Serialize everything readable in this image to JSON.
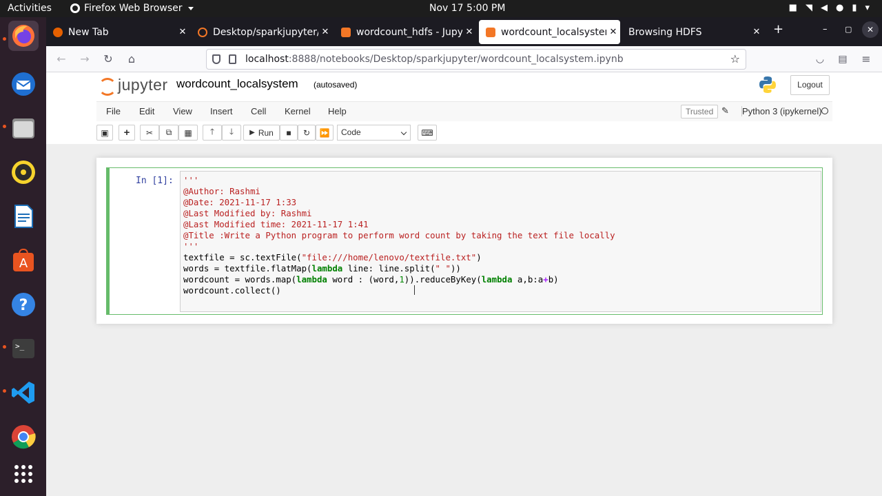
{
  "topbar": {
    "activities": "Activities",
    "app_menu": "Firefox Web Browser",
    "clock": "Nov 17  5:00 PM"
  },
  "tabs": [
    {
      "title": "New Tab",
      "favicon_color": "#e66000"
    },
    {
      "title": "Desktop/sparkjupyter/",
      "favicon_color": "#f37726"
    },
    {
      "title": "wordcount_hdfs - Jupyte",
      "favicon_color": "#f37726"
    },
    {
      "title": "wordcount_localsystem -",
      "favicon_color": "#f37726",
      "active": true
    },
    {
      "title": "Browsing HDFS",
      "favicon_color": "#1c1b22"
    }
  ],
  "url": {
    "host": "localhost",
    "path": ":8888/notebooks/Desktop/sparkjupyter/wordcount_localsystem.ipynb"
  },
  "jupyter": {
    "logo_text": "jupyter",
    "notebook_name": "wordcount_localsystem",
    "autosave_status": "(autosaved)",
    "logout_label": "Logout",
    "menus": [
      "File",
      "Edit",
      "View",
      "Insert",
      "Cell",
      "Kernel",
      "Help"
    ],
    "trusted_label": "Trusted",
    "kernel_name": "Python 3 (ipykernel)",
    "toolbar": {
      "run_label": "Run",
      "cell_type": "Code"
    }
  },
  "cell": {
    "prompt": "In [1]:",
    "lines": [
      "'''",
      "@Author: Rashmi",
      "@Date: 2021-11-17 1:33",
      "@Last Modified by: Rashmi",
      "@Last Modified time: 2021-11-17 1:41",
      "@Title :Write a Python program to perform word count by taking the text file locally",
      "'''"
    ],
    "code_line1": [
      "textfile = sc.textFile(",
      "\"file:///home/lenovo/textfile.txt\"",
      ")"
    ],
    "code_line2": [
      "words = textfile.flatMap(",
      "lambda",
      " line: line.split(",
      "\" \"",
      "))"
    ],
    "code_line3": [
      "wordcount = words.map(",
      "lambda",
      " word : (word,",
      "1",
      ")).reduceByKey(",
      "lambda",
      " a,b:a",
      "+",
      "b)"
    ],
    "code_line4": "wordcount.collect()"
  },
  "colors": {
    "accent_orange": "#f37726",
    "cell_selected_border": "#66bb6a",
    "string_red": "#ba2121",
    "keyword_green": "#008000",
    "prompt_blue": "#303f9f"
  }
}
